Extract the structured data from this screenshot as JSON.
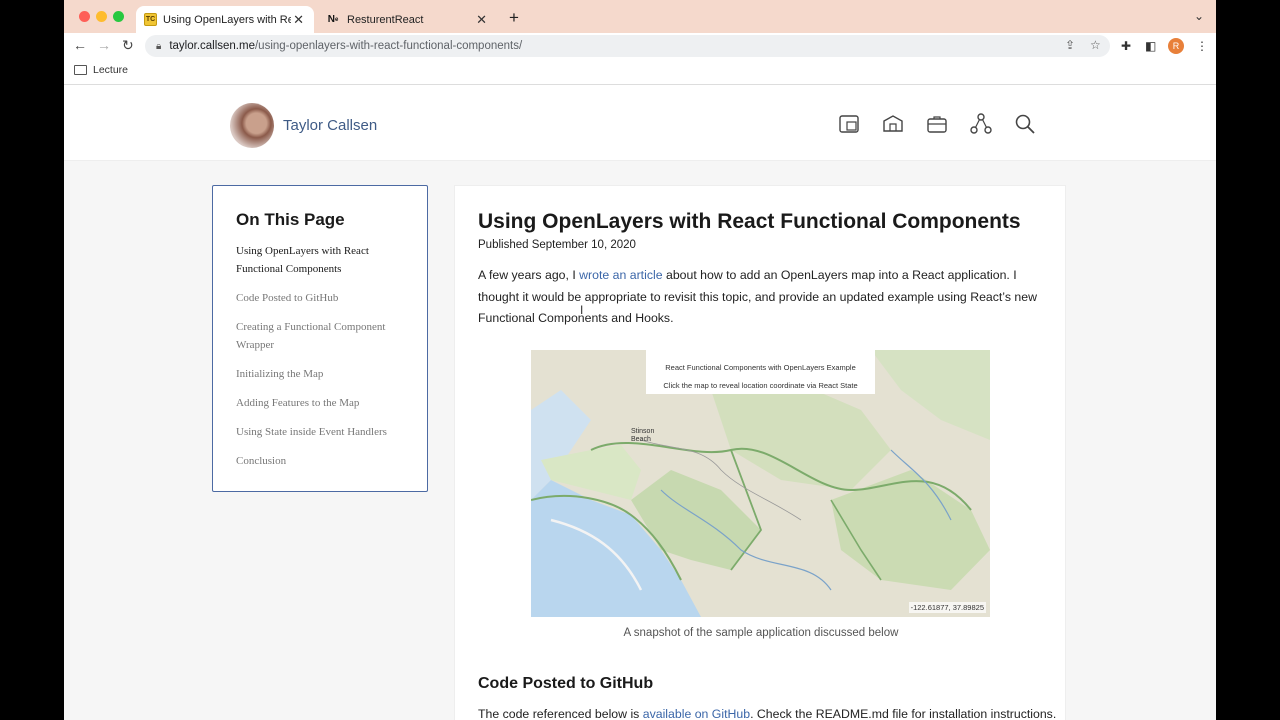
{
  "browser": {
    "tabs": [
      {
        "label": "Using OpenLayers with React F",
        "favicon": "TC",
        "active": true
      },
      {
        "label": "ResturentReact",
        "favicon": "N",
        "active": false
      }
    ],
    "url_host": "taylor.callsen.me",
    "url_path": "/using-openlayers-with-react-functional-components/",
    "bookmark": "Lecture",
    "profile_initial": "R"
  },
  "site": {
    "name": "Taylor Callsen",
    "header_icons": [
      "portfolio-icon",
      "map-icon",
      "briefcase-icon",
      "network-icon",
      "search-icon"
    ]
  },
  "toc": {
    "title": "On This Page",
    "items": [
      "Using OpenLayers with React Functional Components",
      "Code Posted to GitHub",
      "Creating a Functional Component Wrapper",
      "Initializing the Map",
      "Adding Features to the Map",
      "Using State inside Event Handlers",
      "Conclusion"
    ]
  },
  "article": {
    "title": "Using OpenLayers with React Functional Components",
    "date": "Published September 10, 2020",
    "intro_1": "A few years ago, I ",
    "intro_link": "wrote an article",
    "intro_2": " about how to add an OpenLayers map into a React application. I thought it would be appropriate to revisit this topic, and provide an updated example using React’s new Functional Components and Hooks.",
    "map_title": "React Functional Components with OpenLayers Example",
    "map_subtitle": "Click the map to reveal location coordinate via React State",
    "map_label": "Stinson Beach",
    "map_coords": "-122.61877, 37.89825",
    "caption": "A snapshot of the sample application discussed below",
    "section_heading": "Code Posted to GitHub",
    "section_text_1": "The code referenced below is ",
    "section_link": "available on GitHub",
    "section_text_2": ". Check the README.md file for installation instructions."
  }
}
